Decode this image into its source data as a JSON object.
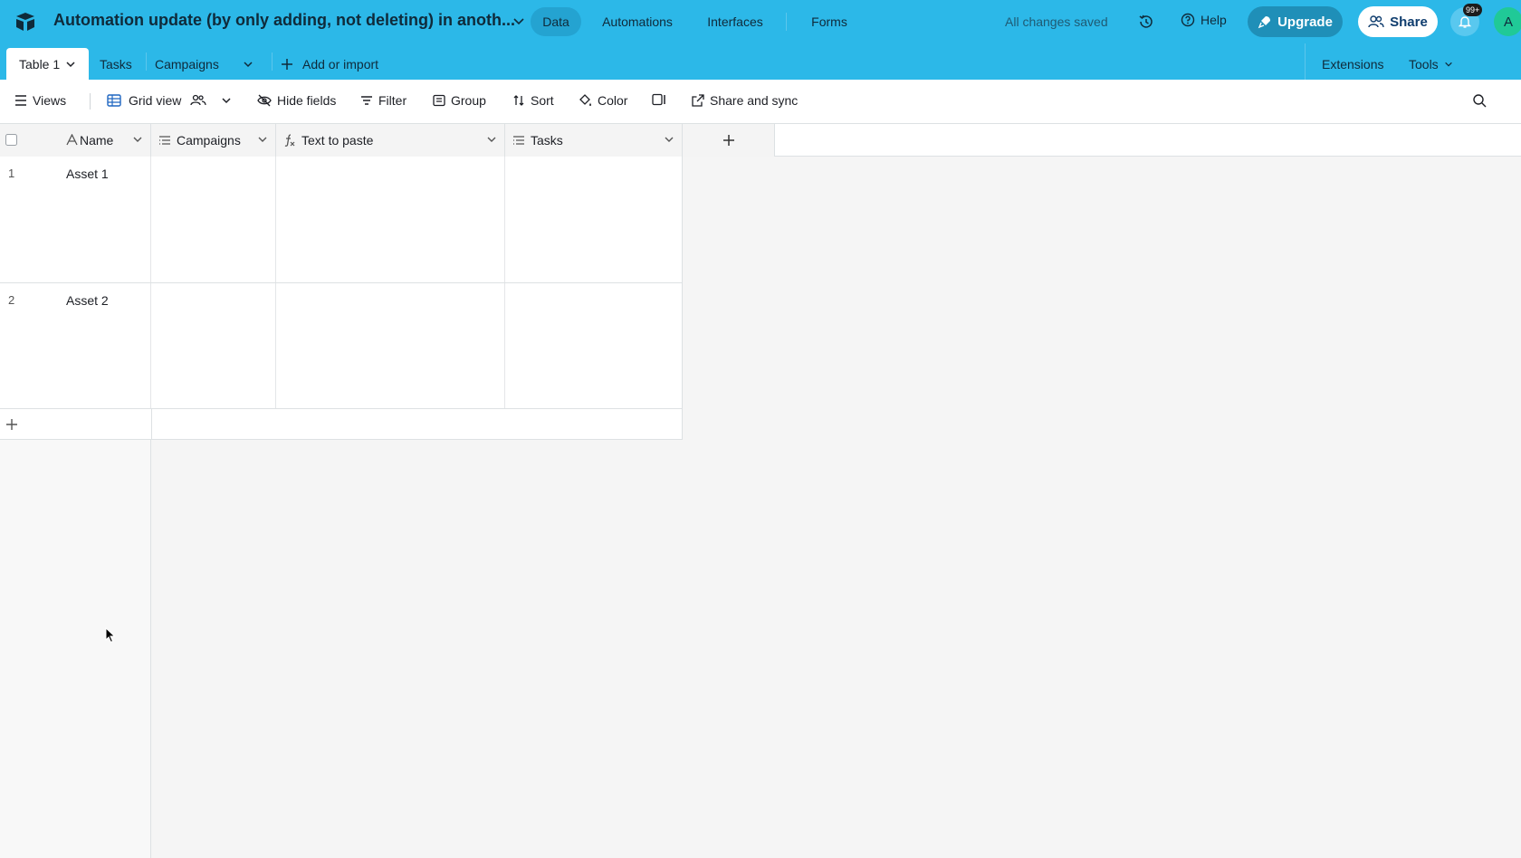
{
  "app": {
    "base_title": "Automation update (by only adding, not deleting) in anoth...",
    "nav": [
      "Data",
      "Automations",
      "Interfaces",
      "Forms"
    ],
    "save_status": "All changes saved",
    "help_label": "Help",
    "upgrade_label": "Upgrade",
    "share_label": "Share",
    "notification_badge": "99+",
    "avatar_initial": "A",
    "accent_color": "#2cb8e8"
  },
  "tables": {
    "active": "Table 1",
    "others": [
      "Tasks",
      "Campaigns"
    ],
    "add_label": "Add or import",
    "extensions_label": "Extensions",
    "tools_label": "Tools"
  },
  "toolbar": {
    "views_label": "Views",
    "grid_view_label": "Grid view",
    "hide_fields_label": "Hide fields",
    "filter_label": "Filter",
    "group_label": "Group",
    "sort_label": "Sort",
    "color_label": "Color",
    "share_sync_label": "Share and sync"
  },
  "grid": {
    "columns": [
      {
        "label": "Name",
        "icon": "text-type-icon"
      },
      {
        "label": "Campaigns",
        "icon": "linked-record-icon"
      },
      {
        "label": "Text to paste",
        "icon": "formula-icon"
      },
      {
        "label": "Tasks",
        "icon": "linked-record-icon"
      }
    ],
    "rows": [
      {
        "num": "1",
        "name": "Asset 1"
      },
      {
        "num": "2",
        "name": "Asset 2"
      }
    ]
  }
}
